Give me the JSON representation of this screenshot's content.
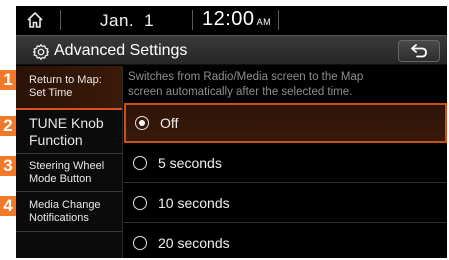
{
  "status": {
    "month": "Jan.",
    "day": "1",
    "time": "12:00",
    "ampm": "AM"
  },
  "header": {
    "title": "Advanced Settings"
  },
  "menu": [
    {
      "label_line1": "Return to Map:",
      "label_line2": "Set Time",
      "callout": "1"
    },
    {
      "label_line1": "TUNE Knob",
      "label_line2": "Function",
      "callout": "2"
    },
    {
      "label_line1": "Steering Wheel",
      "label_line2": "Mode Button",
      "callout": "3"
    },
    {
      "label_line1": "Media Change",
      "label_line2": "Notifications",
      "callout": "4"
    }
  ],
  "content": {
    "description_line1": "Switches from Radio/Media screen to the Map",
    "description_line2": "screen automatically after the selected time.",
    "options": [
      {
        "label": "Off",
        "selected": true
      },
      {
        "label": "5 seconds",
        "selected": false
      },
      {
        "label": "10 seconds",
        "selected": false
      },
      {
        "label": "20 seconds",
        "selected": false
      }
    ]
  },
  "colors": {
    "accent": "#d9531e",
    "callout": "#f07a2a",
    "background": "#000000"
  },
  "icons": {
    "home": "home-icon",
    "gear": "gear-icon",
    "back": "back-arrow-icon"
  }
}
